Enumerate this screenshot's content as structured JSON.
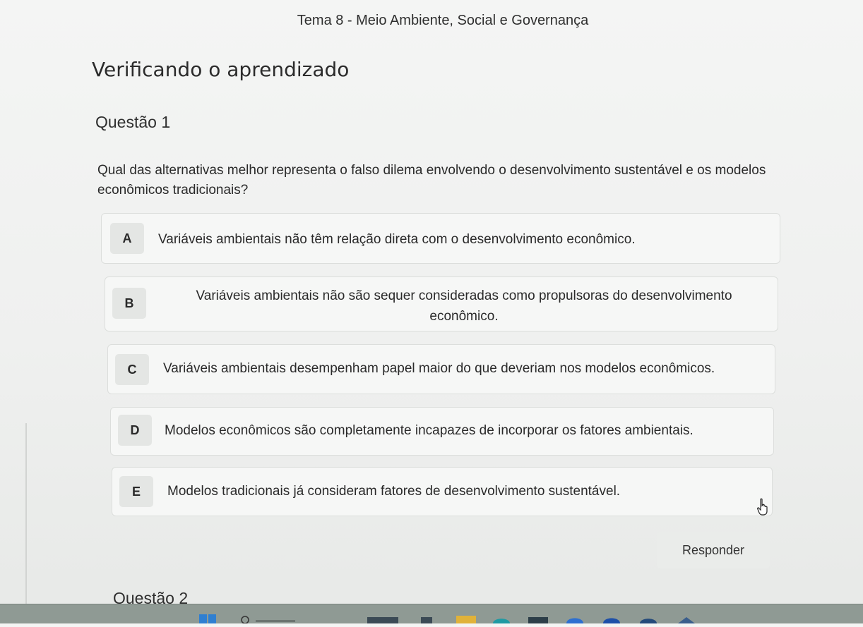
{
  "page": {
    "topic": "Tema 8 - Meio Ambiente, Social e Governança",
    "heading": "Verificando o aprendizado"
  },
  "question": {
    "number_label": "Questão 1",
    "text": "Qual das alternativas melhor representa o falso dilema envolvendo o desenvolvimento sustentável e os modelos econômicos tradicionais?",
    "options": [
      {
        "letter": "A",
        "text": "Variáveis ambientais não têm relação direta com o desenvolvimento econômico."
      },
      {
        "letter": "B",
        "text": "Variáveis ambientais não são sequer consideradas como propulsoras do desenvolvimento econômico."
      },
      {
        "letter": "C",
        "text": "Variáveis ambientais desempenham papel maior do que deveriam nos modelos econômicos."
      },
      {
        "letter": "D",
        "text": "Modelos econômicos são completamente incapazes de incorporar os fatores ambientais."
      },
      {
        "letter": "E",
        "text": "Modelos tradicionais já consideram fatores de desenvolvimento sustentável."
      }
    ],
    "submit_label": "Responder"
  },
  "next_question_label": "Questão 2",
  "icons": {
    "cursor": "hand-pointer-icon",
    "taskbar": [
      "windows-start-icon",
      "search-icon",
      "file-explorer-icon",
      "edge-icon",
      "app-icon"
    ]
  },
  "colors": {
    "option_background": "#f6f7f6",
    "letter_badge": "#e4e6e4",
    "button_background": "#eaecea",
    "taskbar": "#8f9a94"
  }
}
